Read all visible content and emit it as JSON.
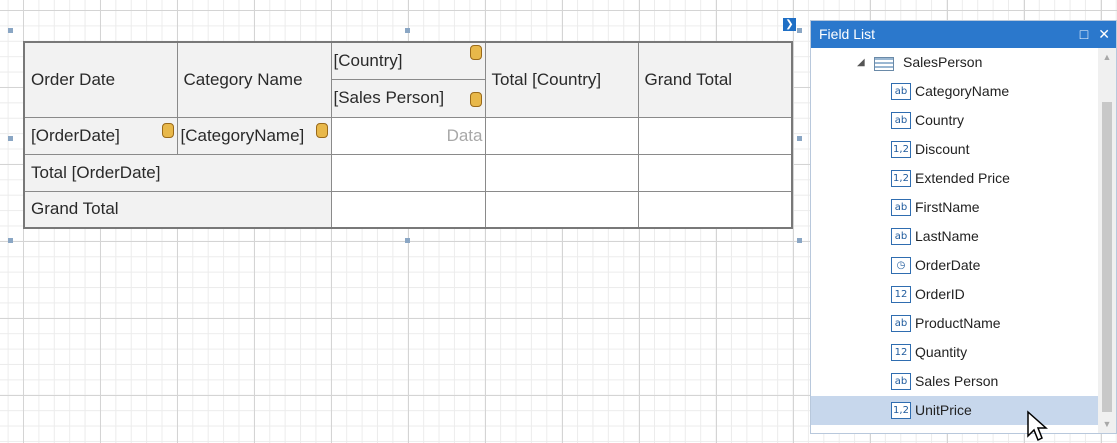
{
  "pivot": {
    "header": {
      "order_date": "Order Date",
      "category_name": "Category Name",
      "country": "[Country]",
      "sales_person": "[Sales Person]",
      "total_country": "Total [Country]",
      "grand_total": "Grand Total"
    },
    "row_fields": {
      "order_date": "[OrderDate]",
      "category_name": "[CategoryName]",
      "data": "Data"
    },
    "total_row": "Total [OrderDate]",
    "grand_total_row": "Grand Total"
  },
  "field_list": {
    "title": "Field List",
    "root": "SalesPerson",
    "fields": [
      {
        "label": "CategoryName",
        "type_glyph": "ab"
      },
      {
        "label": "Country",
        "type_glyph": "ab"
      },
      {
        "label": "Discount",
        "type_glyph": "1,2"
      },
      {
        "label": "Extended Price",
        "type_glyph": "1,2"
      },
      {
        "label": "FirstName",
        "type_glyph": "ab"
      },
      {
        "label": "LastName",
        "type_glyph": "ab"
      },
      {
        "label": "OrderDate",
        "type_glyph": "◷"
      },
      {
        "label": "OrderID",
        "type_glyph": "12"
      },
      {
        "label": "ProductName",
        "type_glyph": "ab"
      },
      {
        "label": "Quantity",
        "type_glyph": "12"
      },
      {
        "label": "Sales Person",
        "type_glyph": "ab"
      },
      {
        "label": "UnitPrice",
        "type_glyph": "1,2"
      }
    ],
    "selected_field": "UnitPrice"
  },
  "colors": {
    "accent": "#2b78cc",
    "selection": "#c7d7ec",
    "datasource_icon": "#e8b84a"
  }
}
